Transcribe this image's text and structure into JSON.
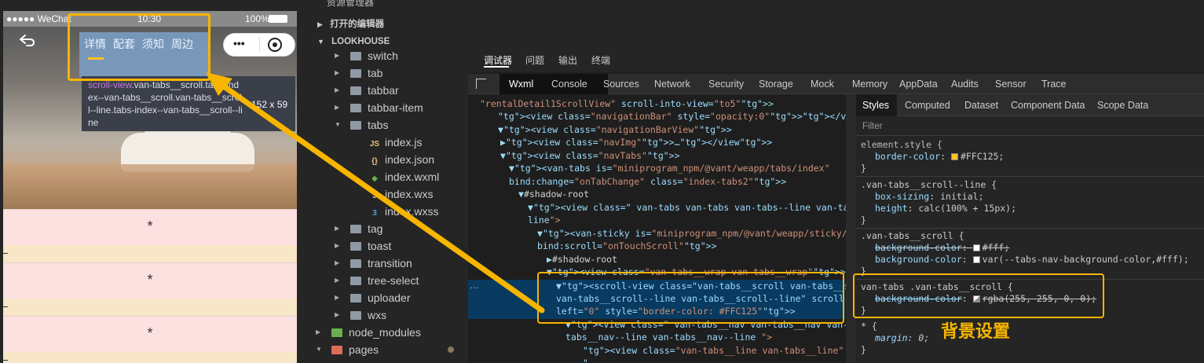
{
  "phone": {
    "status": {
      "carrier": "●●●●● WeChat",
      "time": "10:30",
      "battery": "100%"
    },
    "back_icon": "back-arrow-icon",
    "tabs": [
      "详情",
      "配套",
      "须知",
      "周边"
    ],
    "capsule_more": "•••",
    "rows": [
      "*",
      "*",
      "*"
    ],
    "tooltip": {
      "selector_tag": "scroll-view",
      "selector_rest": ".van-tabs__scroll.tabs-index--van-tabs__scroll.van-tabs__scroll--line.tabs-index--van-tabs__scroll--line",
      "size": "152 x 59"
    }
  },
  "explorer": {
    "title": "资源管理器",
    "sections": [
      "打开的编辑器",
      "LOOKHOUSE"
    ],
    "items": [
      {
        "label": "switch",
        "type": "folder",
        "depth": 2
      },
      {
        "label": "tab",
        "type": "folder",
        "depth": 2
      },
      {
        "label": "tabbar",
        "type": "folder",
        "depth": 2
      },
      {
        "label": "tabbar-item",
        "type": "folder",
        "depth": 2
      },
      {
        "label": "tabs",
        "type": "folder-open",
        "depth": 2
      },
      {
        "label": "index.js",
        "type": "js",
        "depth": 3
      },
      {
        "label": "index.json",
        "type": "json",
        "depth": 3
      },
      {
        "label": "index.wxml",
        "type": "wxml",
        "depth": 3
      },
      {
        "label": "index.wxs",
        "type": "wxs",
        "depth": 3
      },
      {
        "label": "index.wxss",
        "type": "wxss",
        "depth": 3
      },
      {
        "label": "tag",
        "type": "folder",
        "depth": 2
      },
      {
        "label": "toast",
        "type": "folder",
        "depth": 2
      },
      {
        "label": "transition",
        "type": "folder",
        "depth": 2
      },
      {
        "label": "tree-select",
        "type": "folder",
        "depth": 2
      },
      {
        "label": "uploader",
        "type": "folder",
        "depth": 2
      },
      {
        "label": "wxs",
        "type": "folder",
        "depth": 2
      },
      {
        "label": "node_modules",
        "type": "folder-green",
        "depth": 1
      },
      {
        "label": "pages",
        "type": "folder-red",
        "depth": 1
      }
    ]
  },
  "devtools": {
    "top_tabs": [
      "调试器",
      "问题",
      "输出",
      "终端"
    ],
    "panel_tabs": [
      "Wxml",
      "Console",
      "Sources",
      "Network",
      "Security",
      "Storage",
      "Mock",
      "Memory",
      "AppData",
      "Audits",
      "Sensor",
      "Trace"
    ],
    "active_panel": "Wxml",
    "wxml_lines": [
      "\"rentalDetail1ScrollView\" scroll-into-view=\"to5\">",
      "<view class=\"navigationBar\" style=\"opacity:0\"></view>",
      "▼<view class=\"navigationBarView\">",
      "▶<view class=\"navImg\">…</view>",
      "▼<view class=\"navTabs\">",
      "▼<van-tabs is=\"miniprogram_npm/@vant/weapp/tabs/index\"",
      "bind:change=\"onTabChange\" class=\"index-tabs2\">",
      "▼#shadow-root",
      "▼<view class=\" van-tabs van-tabs van-tabs--line van-tabs--",
      "line\">",
      "▼<van-sticky is=\"miniprogram_npm/@vant/weapp/sticky/index\"",
      "bind:scroll=\"onTouchScroll\">",
      "▶#shadow-root",
      "▼<view class=\"van-tabs__wrap van-tabs__wrap\">",
      "▼<scroll-view class=\"van-tabs__scroll van-tabs__scroll",
      "van-tabs__scroll--line van-tabs__scroll--line\" scroll-",
      "left=\"0\" style=\"border-color: #FFC125\">",
      "▼<view class=\" van-tabs__nav van-tabs__nav van-",
      "tabs__nav--line van-tabs__nav--line \">",
      "<view class=\"van-tabs__line van-tabs__line\" style=",
      "\""
    ],
    "styles_tabs": [
      "Styles",
      "Computed",
      "Dataset",
      "Component Data",
      "Scope Data"
    ],
    "filter_placeholder": "Filter",
    "rules": {
      "r1_sel": "element.style {",
      "r1_p1": "border-color",
      "r1_v1": "#FFC125;",
      "r2_sel": ".van-tabs__scroll--line {",
      "r2_p1": "box-sizing",
      "r2_v1": "initial;",
      "r2_p2": "height",
      "r2_v2": "calc(100% + 15px);",
      "r3_sel": ".van-tabs__scroll {",
      "r3_p1": "background-color",
      "r3_v1": "#fff;",
      "r3_p2": "background-color",
      "r3_v2": "var(--tabs-nav-background-color,#fff);",
      "r4_sel": "van-tabs .van-tabs__scroll {",
      "r4_p1": "background-color",
      "r4_v1": "rgba(255, 255, 0, 0);",
      "r5_sel": "* {",
      "r5_p1": "margin",
      "r5_v1": "0;",
      "close": "}"
    },
    "annotation": "背景设置",
    "dots": "…"
  },
  "colors": {
    "accent": "#f7b500",
    "tab_underline": "#ffc125"
  }
}
